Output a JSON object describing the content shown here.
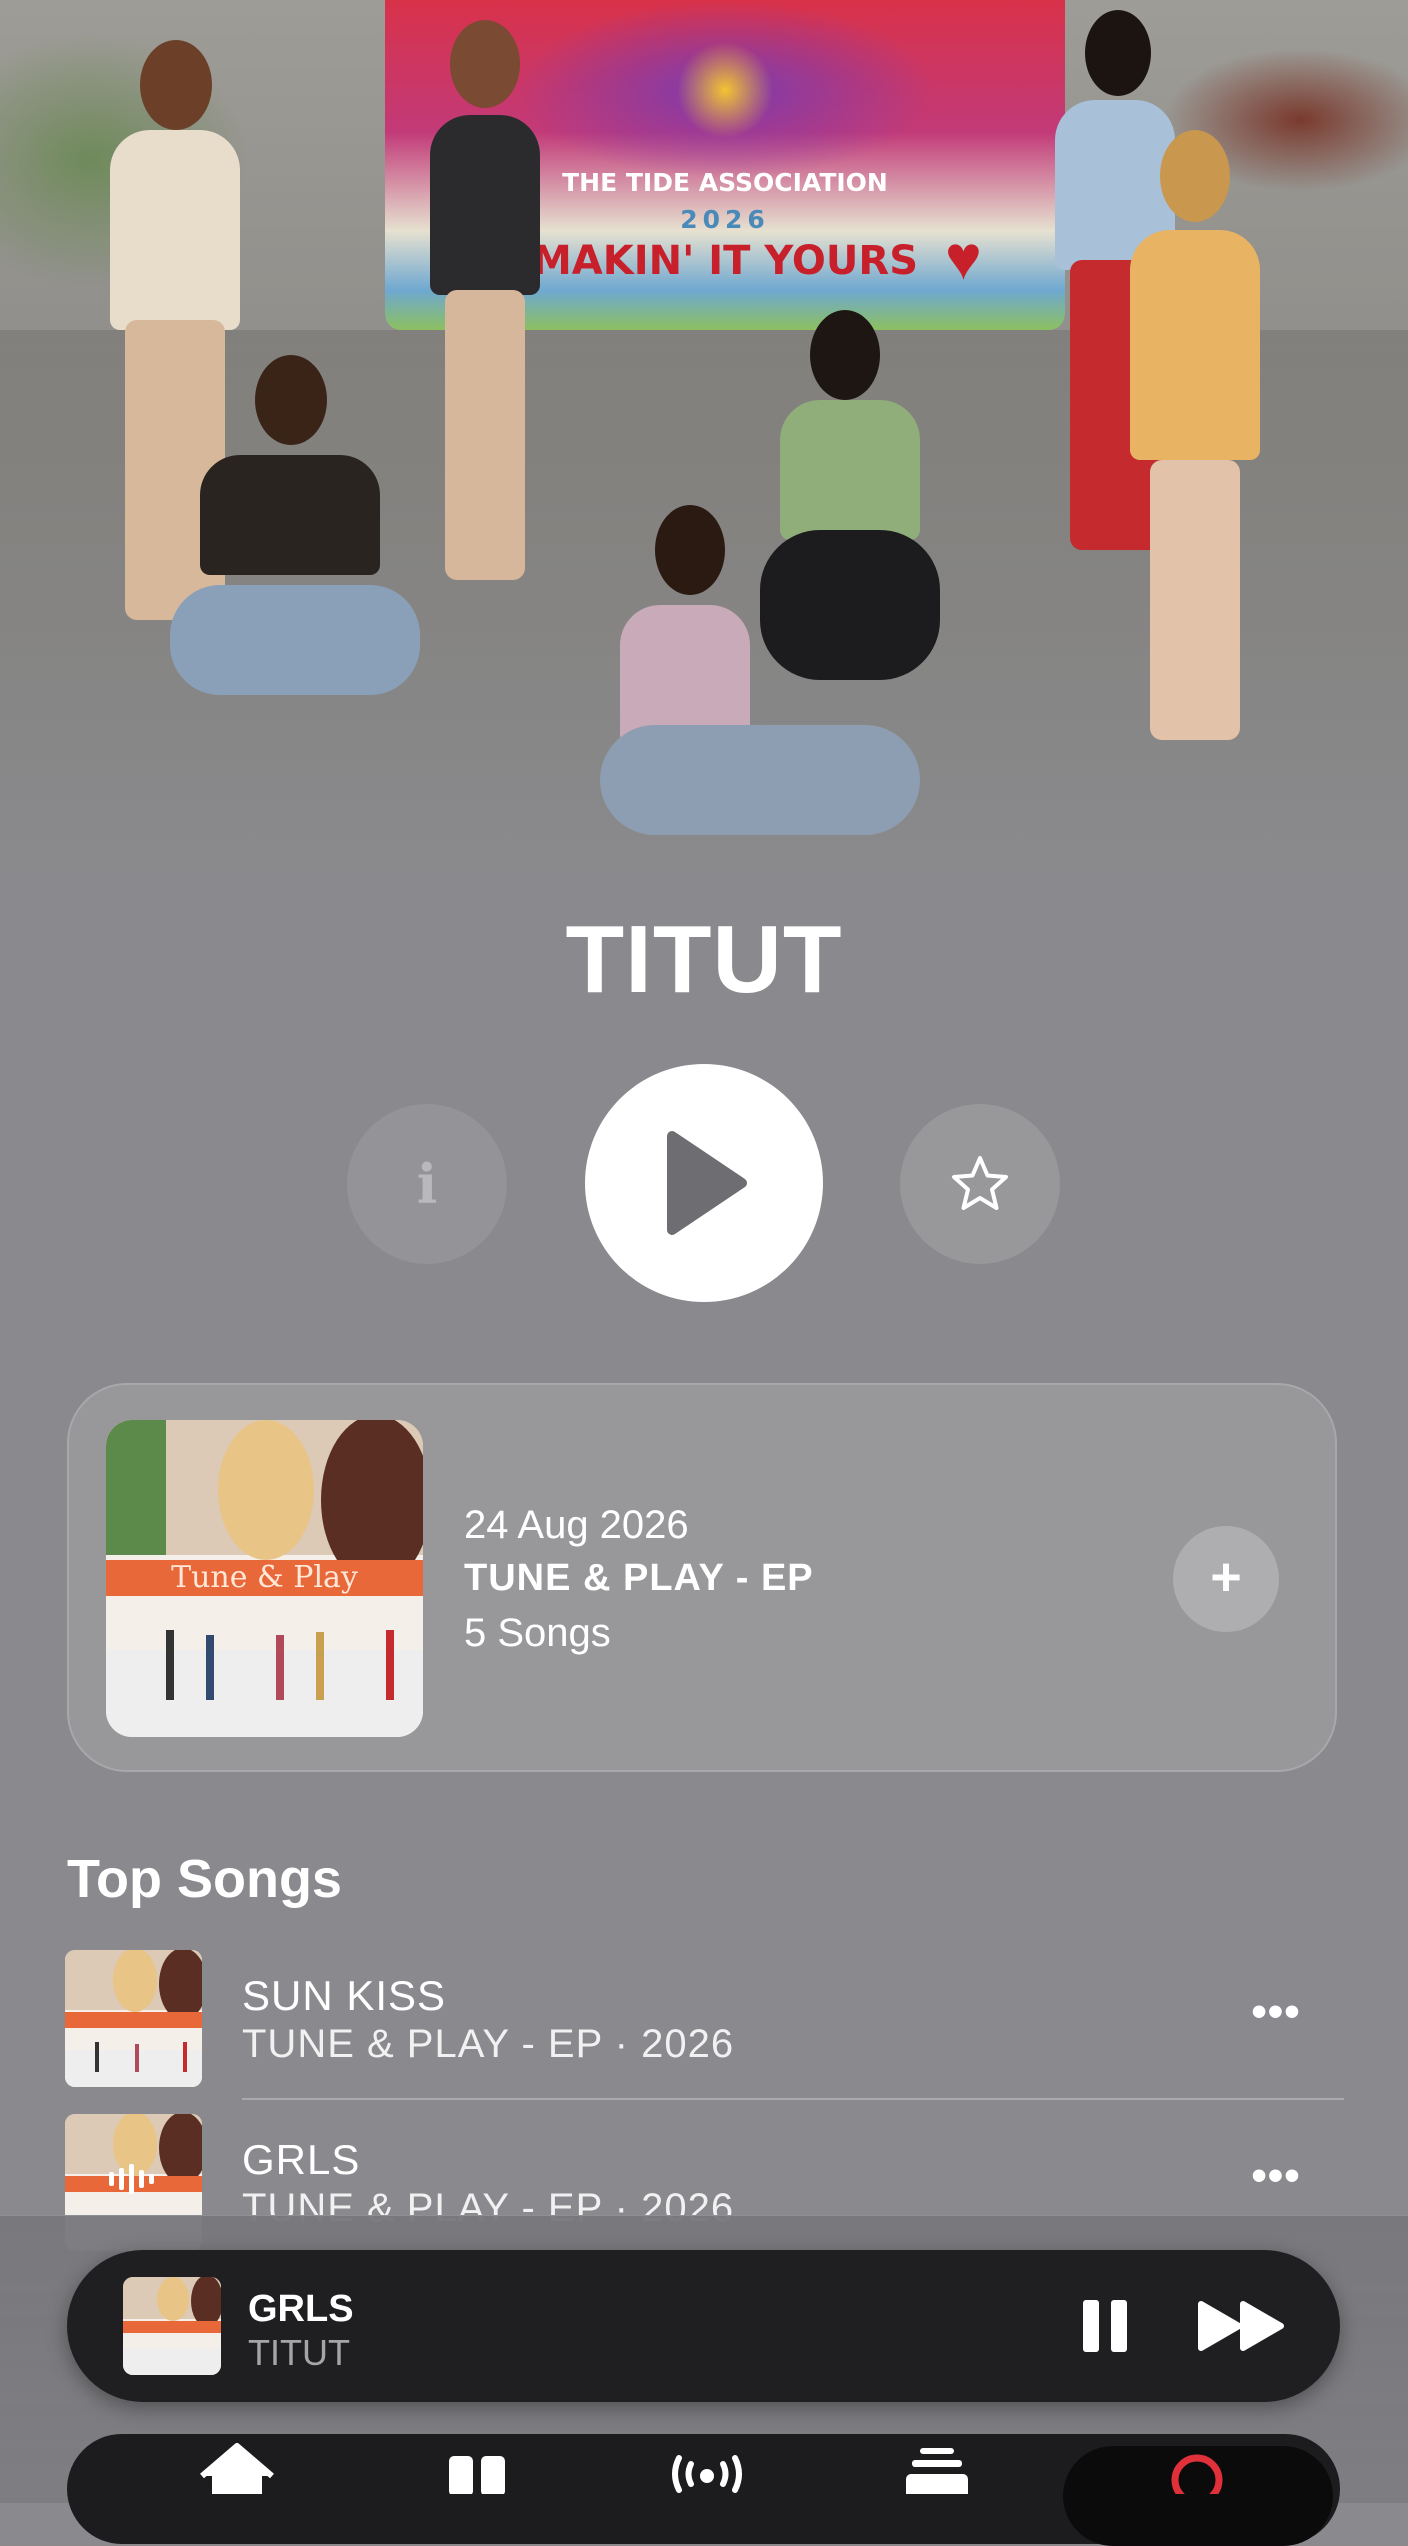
{
  "artist": {
    "name": "TITUT",
    "banner": {
      "line1": "THE TIDE ASSOCIATION",
      "line2": "2026",
      "line3": "MAKIN' IT YOURS"
    }
  },
  "actions": {
    "info_icon": "info-icon",
    "play_icon": "play-icon",
    "favorite_icon": "star-icon"
  },
  "latest_release": {
    "date": "24 Aug 2026",
    "title": "TUNE & PLAY - EP",
    "song_count": "5 Songs",
    "artwork_text": "Tune & Play",
    "add_label": "+"
  },
  "top_songs": {
    "heading": "Top Songs",
    "items": [
      {
        "title": "SUN KISS",
        "subtitle": "TUNE & PLAY - EP · 2026",
        "more": "•••"
      },
      {
        "title": "GRLS",
        "subtitle": "TUNE & PLAY - EP · 2026",
        "more": "•••"
      }
    ]
  },
  "now_playing": {
    "title": "GRLS",
    "artist": "TITUT",
    "pause_icon": "pause-icon",
    "forward_icon": "fast-forward-icon"
  },
  "tab_bar": {
    "tabs": [
      {
        "icon": "home-icon"
      },
      {
        "icon": "new-icon"
      },
      {
        "icon": "radio-icon"
      },
      {
        "icon": "library-icon"
      },
      {
        "icon": "search-icon",
        "active": true
      }
    ]
  },
  "colors": {
    "background": "#8a8a8e",
    "card": "rgba(255,255,255,0.12)",
    "player": "#1f1f22",
    "accent_red": "#e0313a",
    "art_orange": "#e8683a"
  }
}
